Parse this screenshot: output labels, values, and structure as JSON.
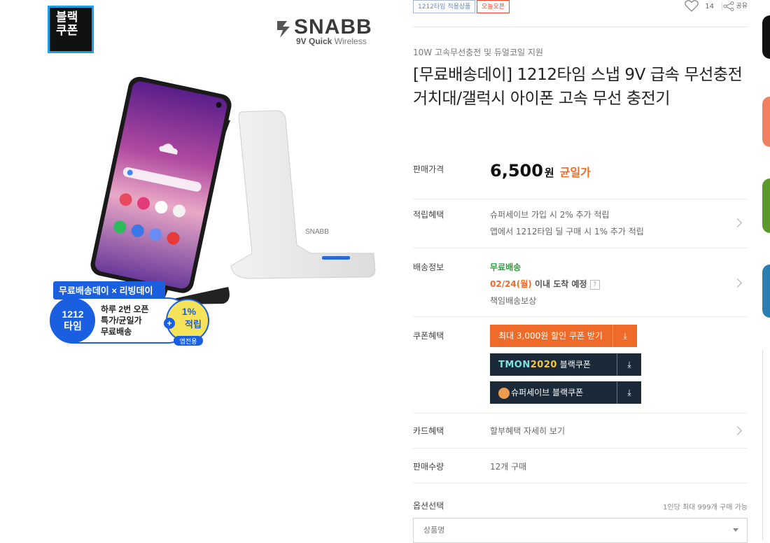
{
  "left": {
    "black_coupon": [
      "블랙",
      "쿠폰"
    ],
    "brand": {
      "name": "SNABB",
      "sub_bold": "9V Quick",
      "sub_rest": " Wireless"
    },
    "promo": {
      "ribbon": "무료배송데이 × 리빙데이",
      "time_line1": "1212",
      "time_line2": "타임",
      "desc_line1": "하루 2번 오픈",
      "desc_line2": "특가/균일가",
      "desc_line3": "무료배송",
      "reward_pct": "1%",
      "reward_label": "적립",
      "reward_sub": "앱전용"
    },
    "stand_label": "SNABB"
  },
  "badges": {
    "applied": "1212타임 적용상품",
    "open": "오늘오픈"
  },
  "likes": {
    "count": "14",
    "share_label": "공유"
  },
  "subtitle": "10W 고속무선충전 및 듀얼코일 지원",
  "title": "[무료배송데이] 1212타임 스냅 9V 급속 무선충전 거치대/갤럭시 아이폰 고속 무선 충전기",
  "rows": {
    "price": {
      "label": "판매가격",
      "amount": "6,500",
      "unit": "원",
      "note": "균일가"
    },
    "points": {
      "label": "적립혜택",
      "line1": "슈퍼세이브 가입 시 2% 추가 적립",
      "line2": "앱에서 1212타임 딜 구매 시 1% 추가 적립"
    },
    "delivery": {
      "label": "배송정보",
      "free": "무료배송",
      "date": "02/24(월)",
      "arrival": " 이내 도착 예정",
      "help": "?",
      "guarantee": "책임배송보상"
    },
    "coupon": {
      "label": "쿠폰혜택",
      "btn1": "최대 3,000원 할인 쿠폰 받기",
      "btn2_logo_a": "TMON",
      "btn2_logo_b": "2020",
      "btn2_text": " 블랙쿠폰",
      "btn3": "슈퍼세이브 블랙쿠폰",
      "download_icon": "⤓"
    },
    "card": {
      "label": "카드혜택",
      "value": "할부혜택 자세히 보기"
    },
    "sales": {
      "label": "판매수량",
      "value": "12개 구매"
    },
    "option": {
      "label": "옵션선택",
      "limit": "1인당 최대 999개 구매 가능",
      "placeholder": "상품명"
    }
  },
  "colors": {
    "accent": "#ef6b2a",
    "green": "#2c9a3b",
    "dark_coupon": "#1b2a38",
    "coupon_border": "#1aa0e8"
  }
}
